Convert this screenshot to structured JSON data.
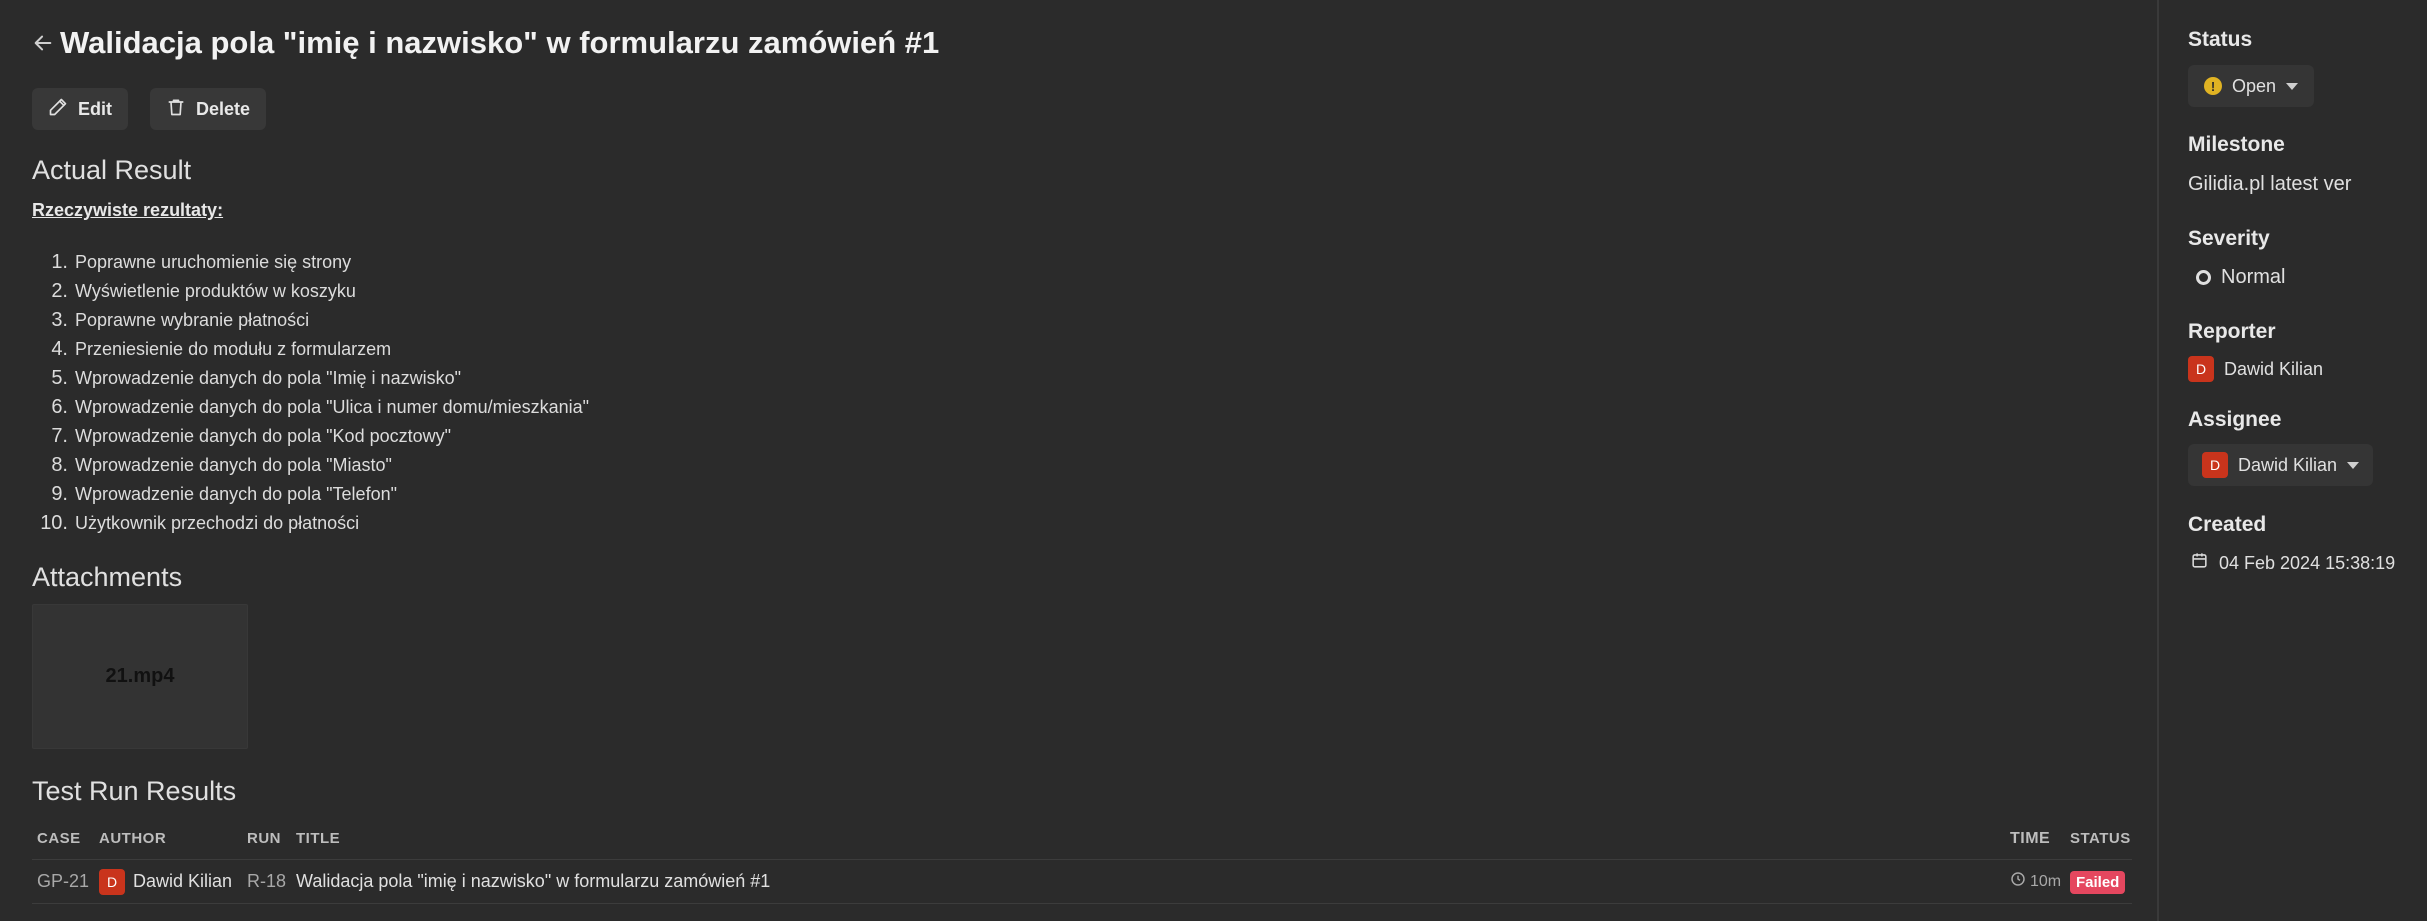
{
  "header": {
    "title": "Walidacja pola \"imię i nazwisko\" w formularzu zamówień #1"
  },
  "toolbar": {
    "edit_label": "Edit",
    "delete_label": "Delete"
  },
  "actual_result": {
    "heading": "Actual Result",
    "subheading": "Rzeczywiste rezultaty:",
    "steps": [
      {
        "num": "1.",
        "text": "Poprawne uruchomienie się strony"
      },
      {
        "num": "2.",
        "text": "Wyświetlenie produktów w koszyku"
      },
      {
        "num": "3.",
        "text": "Poprawne wybranie płatności"
      },
      {
        "num": "4.",
        "text": "Przeniesienie do modułu z formularzem"
      },
      {
        "num": "5.",
        "text": "Wprowadzenie danych do pola \"Imię i nazwisko\""
      },
      {
        "num": "6.",
        "text": "Wprowadzenie danych do pola \"Ulica i numer domu/mieszkania\""
      },
      {
        "num": "7.",
        "text": "Wprowadzenie danych do pola \"Kod pocztowy\""
      },
      {
        "num": "8.",
        "text": "Wprowadzenie danych do pola \"Miasto\""
      },
      {
        "num": "9.",
        "text": "Wprowadzenie danych do pola \"Telefon\""
      },
      {
        "num": "10.",
        "text": "Użytkownik przechodzi do płatności"
      }
    ]
  },
  "attachments": {
    "heading": "Attachments",
    "files": [
      "21.mp4"
    ]
  },
  "test_runs": {
    "heading": "Test Run Results",
    "columns": {
      "case": "CASE",
      "author": "AUTHOR",
      "run": "RUN",
      "title": "TITLE",
      "time": "TIME",
      "status": "STATUS"
    },
    "rows": [
      {
        "case": "GP-21",
        "author_initial": "D",
        "author": "Dawid Kilian",
        "run": "R-18",
        "title": "Walidacja pola \"imię i nazwisko\" w formularzu zamówień #1",
        "time": "10m",
        "status": "Failed"
      }
    ]
  },
  "sidebar": {
    "status_label": "Status",
    "status_value": "Open",
    "status_icon": "!",
    "milestone_label": "Milestone",
    "milestone_value": "Gilidia.pl latest ver",
    "severity_label": "Severity",
    "severity_value": "Normal",
    "reporter_label": "Reporter",
    "reporter_initial": "D",
    "reporter_value": "Dawid Kilian",
    "assignee_label": "Assignee",
    "assignee_initial": "D",
    "assignee_value": "Dawid Kilian",
    "created_label": "Created",
    "created_value": "04 Feb 2024 15:38:19"
  },
  "colors": {
    "background": "#2b2b2b",
    "avatar": "#c9341c",
    "failed": "#e5475f",
    "warning": "#e0b323"
  }
}
